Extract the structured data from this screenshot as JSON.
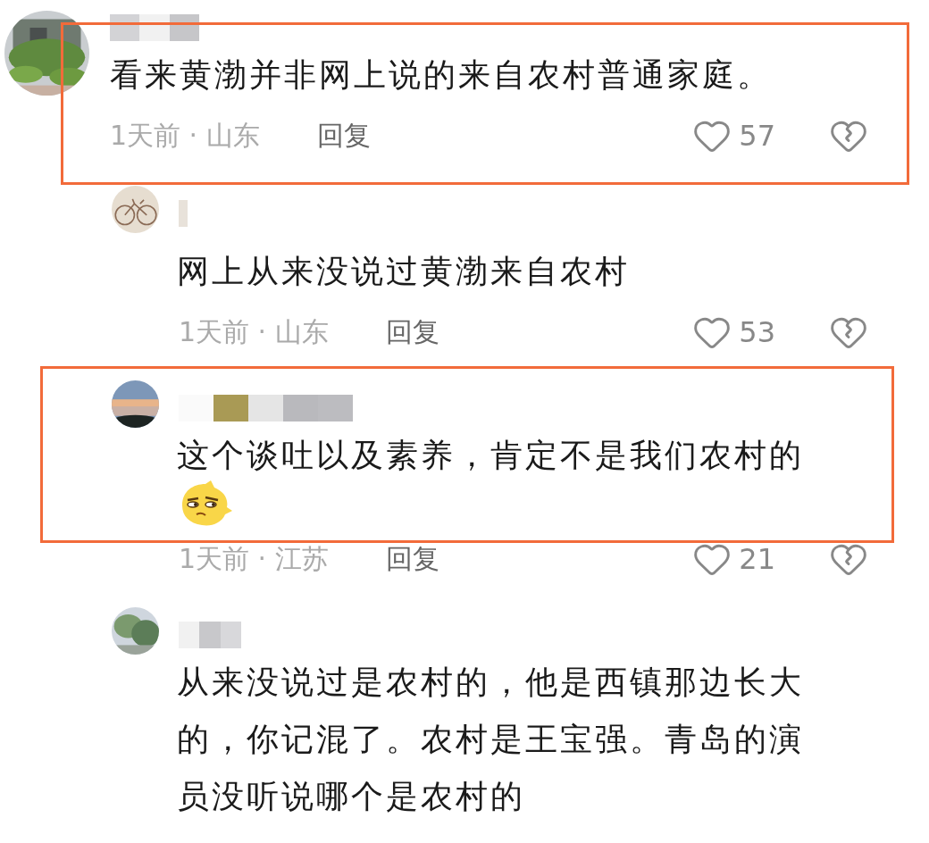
{
  "comments": [
    {
      "kind": "top",
      "highlighted": true,
      "text": "看来黄渤并非网上说的来自农村普通家庭。",
      "time": "1天前 · 山东",
      "reply": "回复",
      "likes": "57"
    },
    {
      "kind": "reply",
      "highlighted": false,
      "text": "网上从来没说过黄渤来自农村",
      "time": "1天前 · 山东",
      "reply": "回复",
      "likes": "53"
    },
    {
      "kind": "reply",
      "highlighted": true,
      "emoji": true,
      "text": "这个谈吐以及素养，肯定不是我们农村的",
      "time": "1天前 · 江苏",
      "reply": "回复",
      "likes": "21"
    },
    {
      "kind": "reply",
      "highlighted": false,
      "text": "从来没说过是农村的，他是西镇那边长大的，你记混了。农村是王宝强。青岛的演员没听说哪个是农村的"
    }
  ]
}
